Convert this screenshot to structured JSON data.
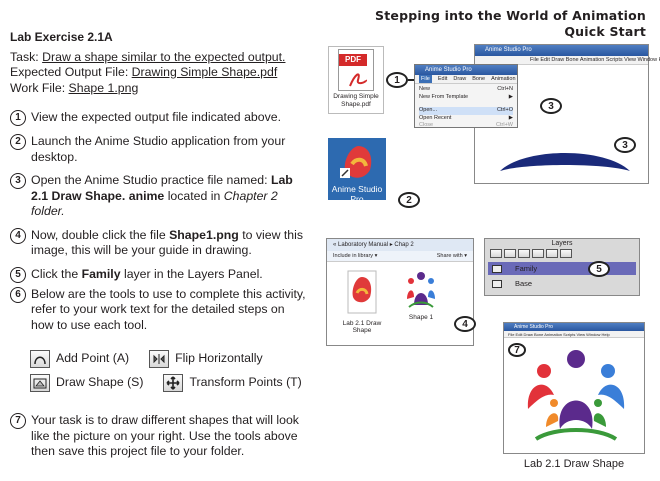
{
  "header": {
    "line1": "Stepping into the World of Animation",
    "line2": "Quick Start"
  },
  "exercise": {
    "title": "Lab Exercise 2.1A",
    "task_prefix": "Task: ",
    "task_link": "Draw a shape similar to the expected output.",
    "expected_prefix": "Expected Output File: ",
    "expected_link": "Drawing Simple Shape.pdf",
    "work_prefix": "Work File: ",
    "work_link": "Shape 1.png"
  },
  "steps": [
    {
      "num": "1",
      "text": "View the expected output file indicated above."
    },
    {
      "num": "2",
      "text": "Launch  the Anime Studio  application from your desktop."
    },
    {
      "num": "3",
      "a": "Open the Anime Studio practice file named: ",
      "b": "Lab 2.1 Draw Shape. anime",
      "c": " located in  ",
      "d": "Chapter 2 folder."
    },
    {
      "num": "4",
      "a": "Now, double click the file ",
      "b": "Shape1.png",
      "c": " to view this image, this will be your guide in drawing."
    },
    {
      "num": "5",
      "a": "Click the ",
      "b": "Family",
      "c": " layer in the Layers Panel."
    },
    {
      "num": "6",
      "text": "Below are the tools to use to complete this activity, refer to your work text for the detailed steps on how to use each tool."
    },
    {
      "num": "7",
      "text": "Your task is to draw different shapes that will look like the picture on your right. Use the tools above then save this project file to your folder."
    }
  ],
  "tools": {
    "add_point": "Add Point (A)",
    "flip_h": "Flip Horizontally",
    "draw_shape": "Draw Shape (S)",
    "transform": "Transform Points (T)"
  },
  "figures": {
    "pdf_label": "PDF",
    "pdf_caption": "Drawing Simple Shape.pdf",
    "app_title": "Anime Studio Pro",
    "menu_items": [
      "File",
      "Edit",
      "Draw",
      "Bone",
      "Animation"
    ],
    "main_menu": "File  Edit  Draw  Bone  Animation  Scripts  View  Window  Help",
    "file_menu": [
      {
        "label": "New",
        "key": "Ctrl+N"
      },
      {
        "label": "New From Template",
        "key": "▶"
      },
      {
        "label": "Open...",
        "key": "Ctrl+O"
      },
      {
        "label": "Open Recent",
        "key": "▶"
      },
      {
        "label": "Close",
        "key": "Ctrl+W"
      }
    ],
    "desktop_icon_label": "Anime Studio Pro",
    "breadcrumb": "« Laboratory Manual ▸ Chap 2",
    "include_library": "Include in library ▾",
    "share_with": "Share with ▾",
    "file1": "Lab 2.1 Draw Shape",
    "file2": "Shape 1",
    "layers_title": "Layers",
    "layer1": "Family",
    "layer2": "Base",
    "result_caption": "Lab 2.1 Draw Shape",
    "c1": "1",
    "c2": "2",
    "c3": "3",
    "c3b": "3",
    "c4": "4",
    "c5": "5",
    "c7": "7"
  },
  "colors": {
    "arc": "#1a2a7a",
    "purple": "#5b2a8c",
    "red": "#e2323a",
    "green": "#3a9a3a",
    "blue": "#3a7ed8",
    "orange": "#f08a2a"
  }
}
